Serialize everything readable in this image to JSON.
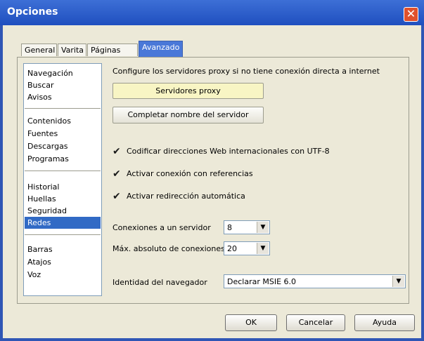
{
  "window": {
    "title": "Opciones",
    "close_glyph": "✕"
  },
  "tabs": [
    {
      "label": "General",
      "active": false
    },
    {
      "label": "Varita",
      "active": false
    },
    {
      "label": "Páginas Web",
      "active": false
    },
    {
      "label": "Avanzado",
      "active": true
    }
  ],
  "nav": {
    "groups": [
      [
        "Navegación",
        "Buscar",
        "Avisos"
      ],
      [
        "Contenidos",
        "Fuentes",
        "Descargas",
        "Programas"
      ],
      [
        "Historial",
        "Huellas",
        "Seguridad",
        "Redes"
      ],
      [
        "Barras",
        "Atajos",
        "Voz"
      ]
    ],
    "selected": "Redes"
  },
  "main": {
    "description": "Configure los servidores proxy si no tiene conexión directa a internet",
    "proxy_button": "Servidores proxy",
    "complete_server_button": "Completar nombre del servidor",
    "checkboxes": [
      {
        "label": "Codificar direcciones Web internacionales con UTF-8",
        "checked": true
      },
      {
        "label": "Activar conexión con referencias",
        "checked": true
      },
      {
        "label": "Activar redirección automática",
        "checked": true
      }
    ],
    "check_glyph": "✔",
    "connections_per_server": {
      "label": "Conexiones a un servidor",
      "value": "8"
    },
    "max_connections": {
      "label": "Máx. absoluto de conexiones",
      "value": "20"
    },
    "browser_identity": {
      "label": "Identidad del navegador",
      "value": "Declarar MSIE 6.0"
    },
    "dropdown_glyph": "▼"
  },
  "footer": {
    "ok": "OK",
    "cancel": "Cancelar",
    "help": "Ayuda"
  },
  "colors": {
    "title_bar": "#2f5fc8",
    "accent": "#316ac5",
    "close": "#e0512c"
  }
}
